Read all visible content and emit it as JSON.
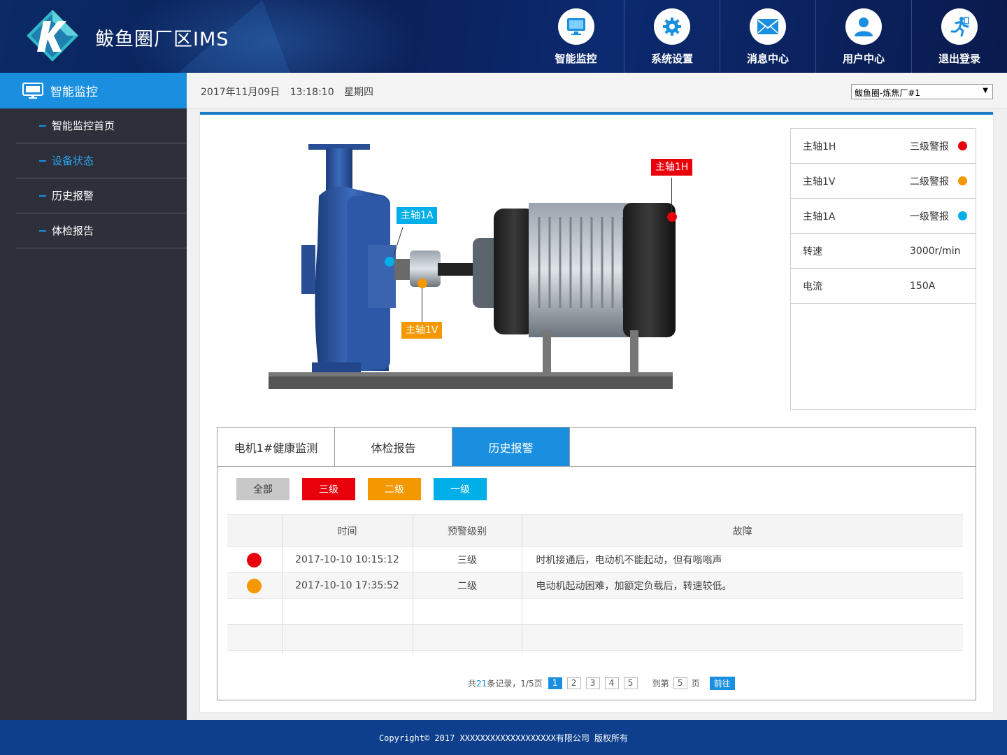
{
  "header": {
    "brand": "鲅鱼圈厂区IMS",
    "nav": [
      {
        "label": "智能监控",
        "icon": "monitor-icon"
      },
      {
        "label": "系统设置",
        "icon": "gear-icon"
      },
      {
        "label": "消息中心",
        "icon": "mail-icon"
      },
      {
        "label": "用户中心",
        "icon": "user-icon"
      },
      {
        "label": "退出登录",
        "icon": "running-man-icon"
      }
    ]
  },
  "sidebar": {
    "title": "智能监控",
    "items": [
      {
        "label": "智能监控首页"
      },
      {
        "label": "设备状态"
      },
      {
        "label": "历史报警"
      },
      {
        "label": "体检报告"
      }
    ]
  },
  "topbar": {
    "date": "2017年11月09日",
    "time": "13:18:10",
    "weekday": "星期四",
    "plant_select": "鲅鱼圈-炼焦厂#1"
  },
  "diagram": {
    "tags": {
      "h": "主轴1H",
      "a": "主轴1A",
      "v": "主轴1V"
    },
    "colors": {
      "level3": "#e8000a",
      "level2": "#f39800",
      "level1": "#00aee8"
    }
  },
  "status": {
    "rows": [
      {
        "name": "主轴1H",
        "value": "三级警报"
      },
      {
        "name": "主轴1V",
        "value": "二级警报"
      },
      {
        "name": "主轴1A",
        "value": "一级警报"
      },
      {
        "name": "转速",
        "value": "3000r/min"
      },
      {
        "name": "电流",
        "value": "150A"
      }
    ]
  },
  "tabs": [
    {
      "label": "电机1#健康监测"
    },
    {
      "label": "体检报告"
    },
    {
      "label": "历史报警"
    }
  ],
  "filters": [
    {
      "label": "全部",
      "color": "#c8c8c8",
      "text_color": "#333333"
    },
    {
      "label": "三级",
      "color": "#e8000a",
      "text_color": "#ffffff"
    },
    {
      "label": "二级",
      "color": "#f39800",
      "text_color": "#ffffff"
    },
    {
      "label": "一级",
      "color": "#00aee8",
      "text_color": "#ffffff"
    }
  ],
  "table": {
    "headers": [
      "",
      "时间",
      "预警级别",
      "故障"
    ],
    "rows": [
      {
        "level_color": "#e8000a",
        "time": "2017-10-10  10:15:12",
        "level": "三级",
        "fault": "时机接通后，电动机不能起动，但有嗡嗡声"
      },
      {
        "level_color": "#f39800",
        "time": "2017-10-10  17:35:52",
        "level": "二级",
        "fault": "电动机起动困难，加额定负载后，转速较低。"
      }
    ]
  },
  "pager": {
    "prefix": "共",
    "total": "21",
    "suffix": "条记录，1/5页",
    "pages": [
      "1",
      "2",
      "3",
      "4",
      "5"
    ],
    "goto_label": "到第",
    "goto_value": "5",
    "page_unit": "页",
    "go_button": "前往"
  },
  "footer": {
    "copyright": "Copyright© 2017 XXXXXXXXXXXXXXXXXXX有限公司 版权所有"
  }
}
